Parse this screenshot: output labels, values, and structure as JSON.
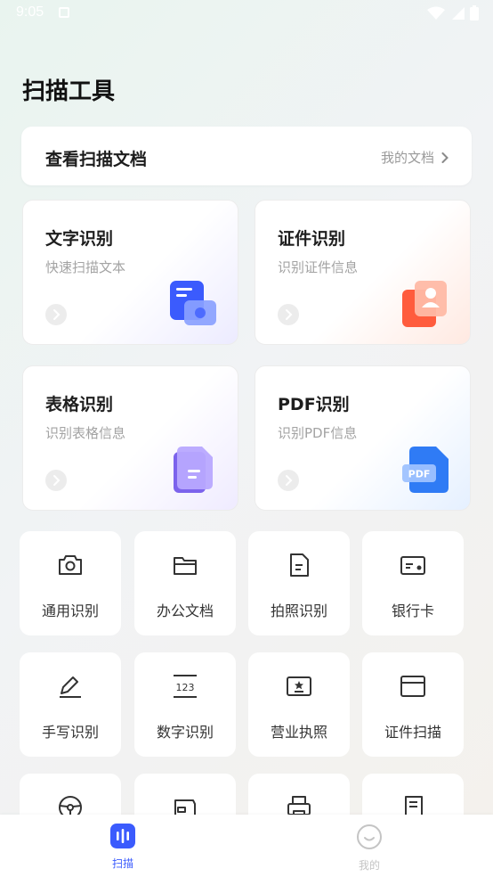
{
  "status": {
    "time": "9:05"
  },
  "page_title": "扫描工具",
  "documents": {
    "title": "查看扫描文档",
    "link": "我的文档"
  },
  "features": [
    {
      "title": "文字识别",
      "subtitle": "快速扫描文本",
      "icon": "text-recognition-icon"
    },
    {
      "title": "证件识别",
      "subtitle": "识别证件信息",
      "icon": "id-card-recognition-icon"
    },
    {
      "title": "表格识别",
      "subtitle": "识别表格信息",
      "icon": "table-recognition-icon"
    },
    {
      "title": "PDF识别",
      "subtitle": "识别PDF信息",
      "icon": "pdf-recognition-icon",
      "badge": "PDF"
    }
  ],
  "tools": [
    {
      "label": "通用识别",
      "icon": "camera-icon"
    },
    {
      "label": "办公文档",
      "icon": "folder-icon"
    },
    {
      "label": "拍照识别",
      "icon": "document-icon"
    },
    {
      "label": "银行卡",
      "icon": "bank-card-icon"
    },
    {
      "label": "手写识别",
      "icon": "pen-icon"
    },
    {
      "label": "数字识别",
      "icon": "number-icon",
      "glyph": "123"
    },
    {
      "label": "营业执照",
      "icon": "license-icon"
    },
    {
      "label": "证件扫描",
      "icon": "wallet-card-icon"
    },
    {
      "label": "",
      "icon": "steering-wheel-icon"
    },
    {
      "label": "",
      "icon": "wallet-icon"
    },
    {
      "label": "",
      "icon": "printer-icon"
    },
    {
      "label": "",
      "icon": "receipt-icon"
    }
  ],
  "nav": [
    {
      "label": "扫描",
      "active": true,
      "icon": "scan-icon"
    },
    {
      "label": "我的",
      "active": false,
      "icon": "profile-icon"
    }
  ],
  "colors": {
    "accent": "#3b5bfd",
    "nav_inactive": "#c4c4c4"
  }
}
